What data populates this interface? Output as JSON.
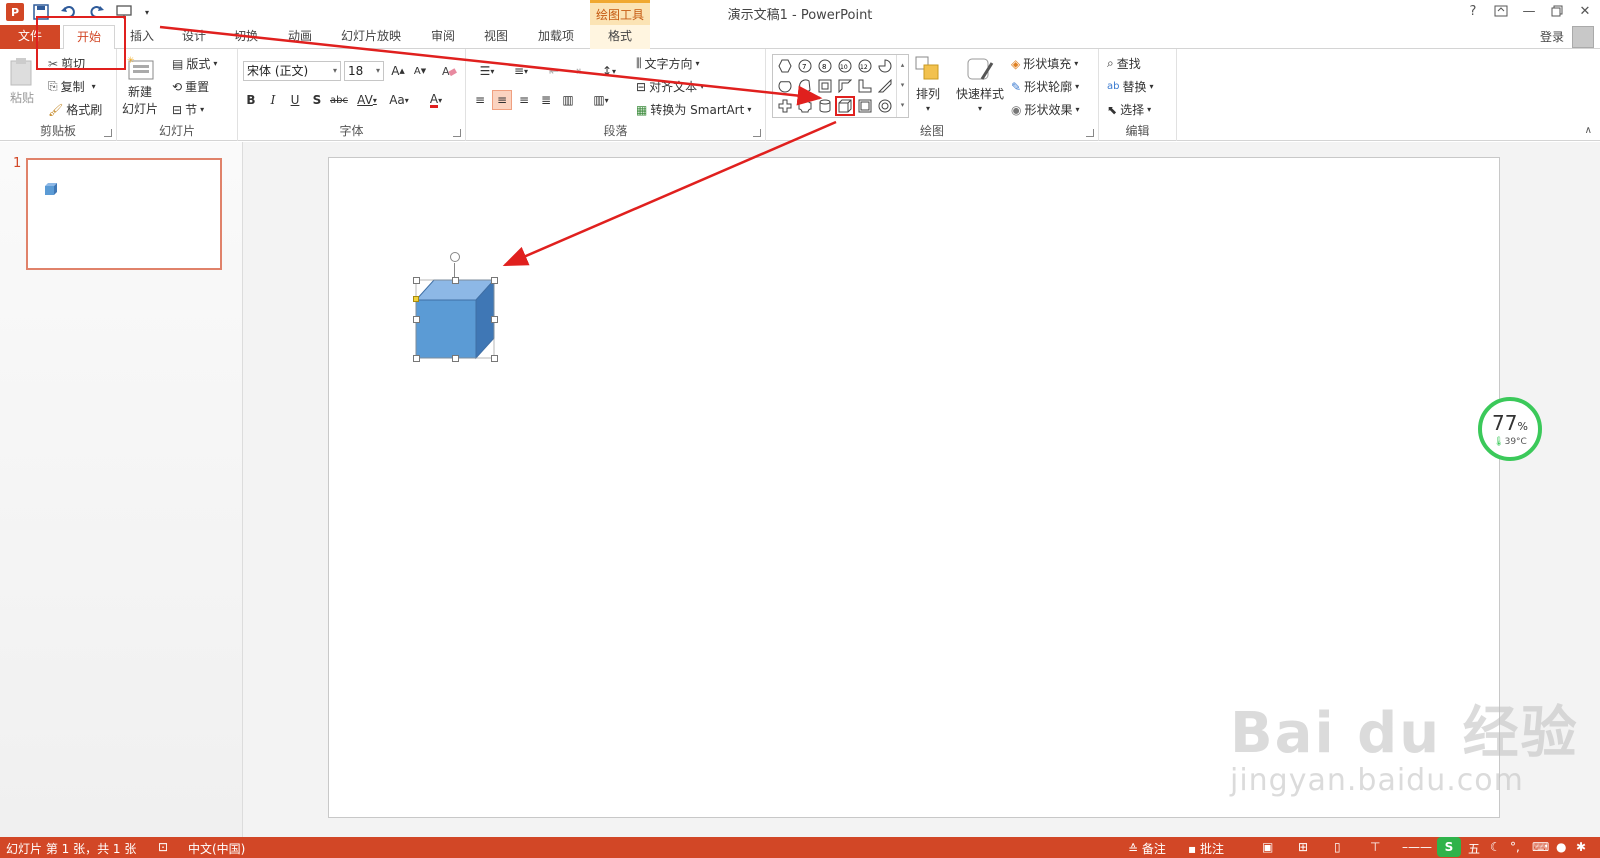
{
  "window": {
    "title": "演示文稿1 - PowerPoint",
    "context_tab_header": "绘图工具",
    "help": "?",
    "signin": "登录"
  },
  "tabs": [
    {
      "label": "文件"
    },
    {
      "label": "开始"
    },
    {
      "label": "插入"
    },
    {
      "label": "设计"
    },
    {
      "label": "切换"
    },
    {
      "label": "动画"
    },
    {
      "label": "幻灯片放映"
    },
    {
      "label": "审阅"
    },
    {
      "label": "视图"
    },
    {
      "label": "加载项"
    },
    {
      "label": "格式"
    }
  ],
  "ribbon": {
    "clipboard": {
      "label": "剪贴板",
      "paste": "粘贴",
      "cut": "剪切",
      "copy": "复制",
      "format_painter": "格式刷"
    },
    "slides": {
      "label": "幻灯片",
      "new_slide": "新建",
      "new_slide2": "幻灯片",
      "layout": "版式",
      "reset": "重置",
      "section": "节"
    },
    "font": {
      "label": "字体",
      "font_name": "宋体 (正文)",
      "font_size": "18",
      "bold": "B",
      "italic": "I",
      "underline": "U",
      "shadow": "S",
      "strike": "abc",
      "spacing": "AV",
      "case": "Aa",
      "color": "A"
    },
    "paragraph": {
      "label": "段落",
      "text_direction": "文字方向",
      "align_text": "对齐文本",
      "smartart": "转换为 SmartArt"
    },
    "drawing": {
      "label": "绘图",
      "arrange": "排列",
      "quick_styles": "快速样式",
      "fill": "形状填充",
      "outline": "形状轮廓",
      "effects": "形状效果"
    },
    "editing": {
      "label": "编辑",
      "find": "查找",
      "replace": "替换",
      "select": "选择"
    }
  },
  "thumbnails": [
    {
      "number": "1"
    }
  ],
  "gauge": {
    "value": "77",
    "unit": "%",
    "temp": "39°C"
  },
  "watermark": {
    "brand": "Bai du 经验",
    "url": "jingyan.baidu.com"
  },
  "status": {
    "slide_info": "幻灯片 第 1 张，共 1 张",
    "language": "中文(中国)",
    "notes": "备注",
    "comments": "批注",
    "ime": "五"
  },
  "colors": {
    "accent": "#d24726",
    "cube_front": "#5b9bd5",
    "annotation": "#e0201e"
  }
}
